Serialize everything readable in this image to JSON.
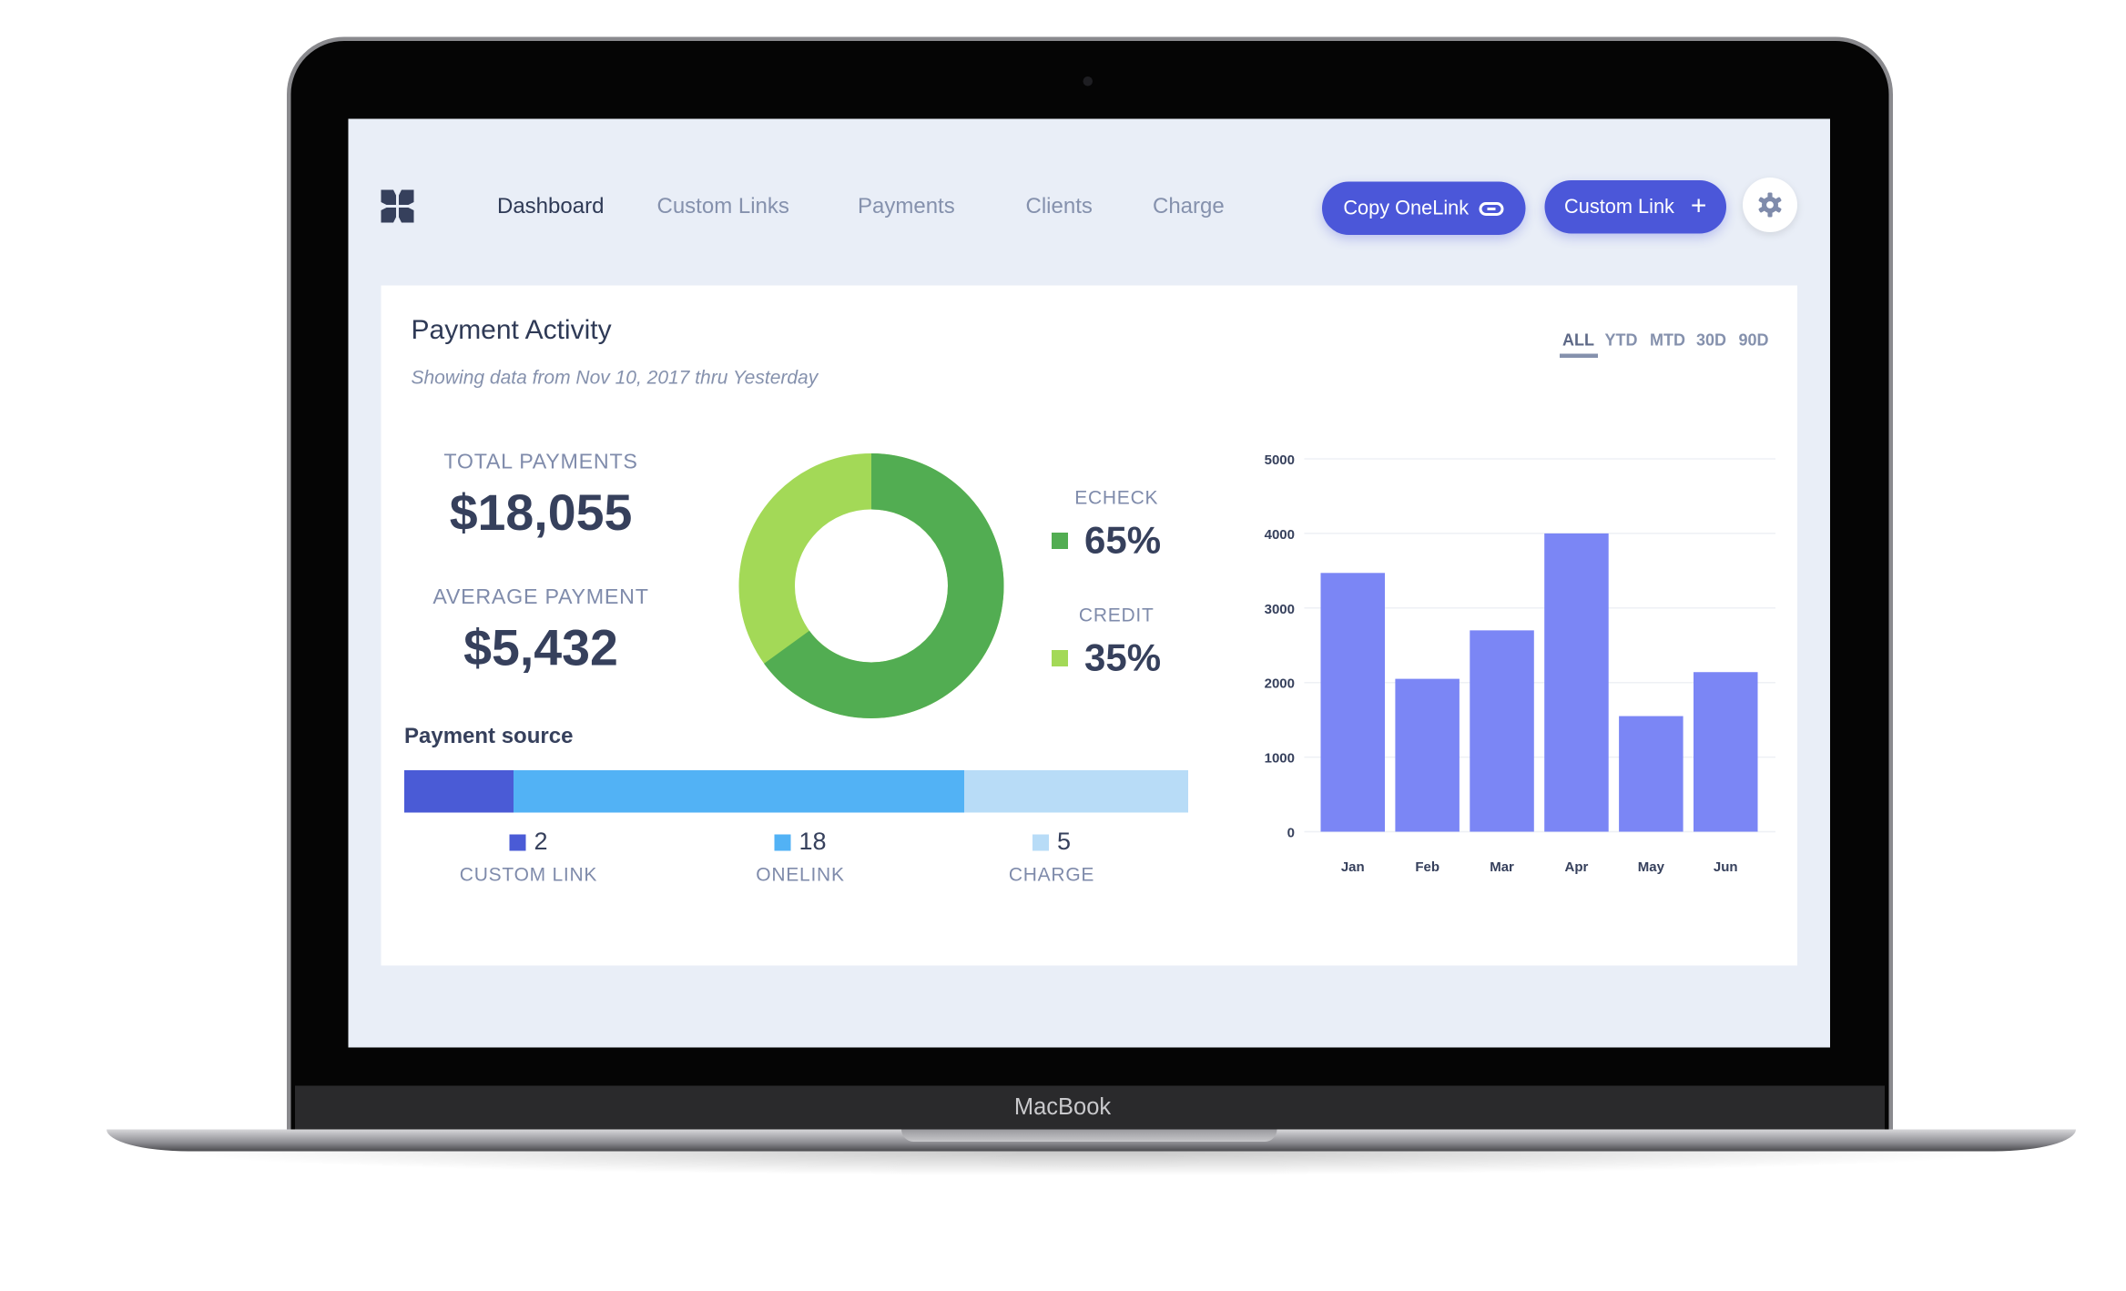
{
  "device": {
    "brand": "MacBook"
  },
  "nav": {
    "items": [
      {
        "label": "Dashboard",
        "active": true
      },
      {
        "label": "Custom Links"
      },
      {
        "label": "Payments"
      },
      {
        "label": "Clients"
      },
      {
        "label": "Charge"
      }
    ],
    "copy_onelink": "Copy OneLink",
    "custom_link": "Custom Link",
    "settings_icon": "gear-icon",
    "logo_icon": "logo-icon"
  },
  "card": {
    "title": "Payment Activity",
    "subtitle": "Showing data from Nov 10, 2017 thru Yesterday",
    "ranges": [
      "ALL",
      "YTD",
      "MTD",
      "30D",
      "90D"
    ],
    "selected_range": "ALL",
    "total_label": "TOTAL PAYMENTS",
    "total_value": "$18,055",
    "avg_label": "AVERAGE PAYMENT",
    "avg_value": "$5,432",
    "split": [
      {
        "label": "ECHECK",
        "value": "65%",
        "color": "#52ad52"
      },
      {
        "label": "CREDIT",
        "value": "35%",
        "color": "#a3d957"
      }
    ],
    "source_title": "Payment source",
    "sources": [
      {
        "label": "CUSTOM LINK",
        "count": "2",
        "color": "#4a5bd6"
      },
      {
        "label": "ONELINK",
        "count": "18",
        "color": "#52b2f5"
      },
      {
        "label": "CHARGE",
        "count": "5",
        "color": "#b8dcf7"
      }
    ]
  },
  "chart_data": {
    "type": "bar",
    "categories": [
      "Jan",
      "Feb",
      "Mar",
      "Apr",
      "May",
      "Jun"
    ],
    "values": [
      3470,
      2050,
      2700,
      4000,
      1550,
      2140
    ],
    "yticks": [
      "0",
      "1000",
      "2000",
      "3000",
      "4000",
      "5000"
    ],
    "ylim": [
      0,
      5000
    ],
    "grid": true,
    "color": "#7b86f5"
  }
}
